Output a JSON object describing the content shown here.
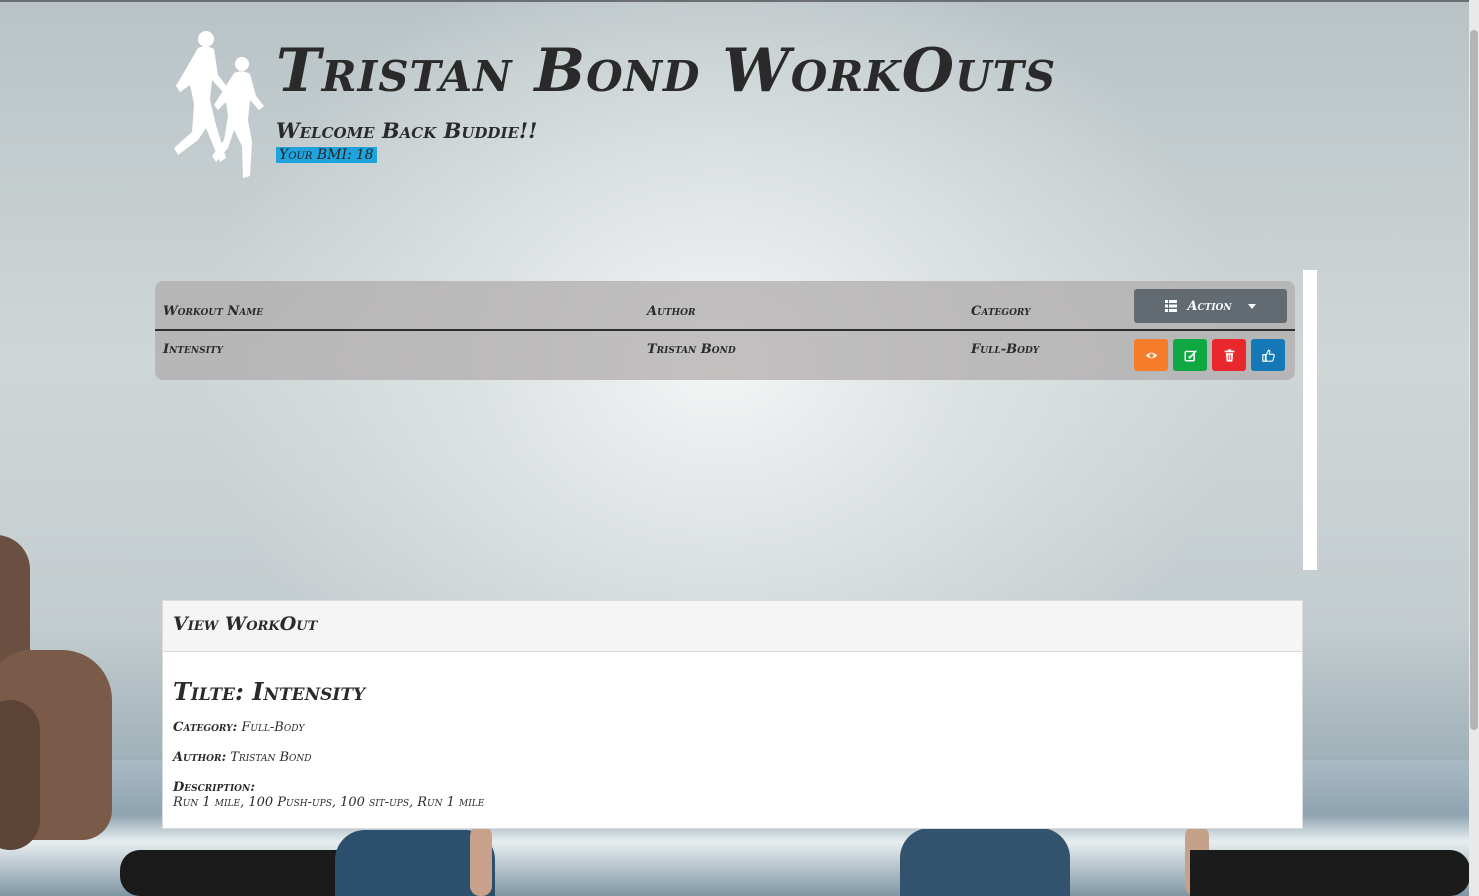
{
  "header": {
    "title": "Tristan Bond WorkOuts",
    "welcome": "Welcome Back Buddie!!",
    "bmi_label": "Your BMI:",
    "bmi_value": "18"
  },
  "table": {
    "columns": [
      "Workout Name",
      "Author",
      "Category"
    ],
    "action_label": "Action",
    "rows": [
      {
        "name": "Intensity",
        "author": "Tristan Bond",
        "category": "Full-Body"
      }
    ],
    "row_buttons": [
      {
        "icon": "eye-icon",
        "color": "#f47c2a"
      },
      {
        "icon": "edit-icon",
        "color": "#10a843"
      },
      {
        "icon": "trash-icon",
        "color": "#e8282c"
      },
      {
        "icon": "thumbs-up-icon",
        "color": "#1378b5"
      }
    ]
  },
  "view": {
    "panel_title": "View WorkOut",
    "title_label": "Tilte:",
    "title_value": "Intensity",
    "category_label": "Category:",
    "category_value": "Full-Body",
    "author_label": "Author:",
    "author_value": "Tristan Bond",
    "description_label": "Description:",
    "description_value": "Run 1 mile, 100 Push-ups, 100 sit-ups, Run 1 mile"
  },
  "colors": {
    "bmi_highlight": "#1fa3dc",
    "action_button": "#616b71"
  }
}
